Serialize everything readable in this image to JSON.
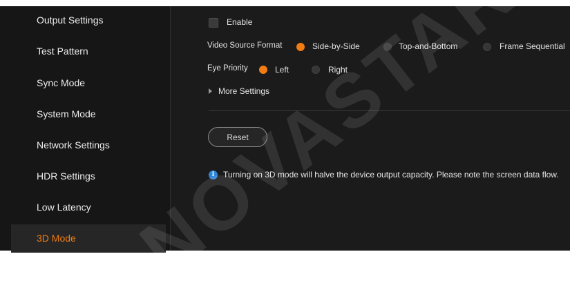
{
  "sidebar": {
    "items": [
      {
        "label": "Output Settings"
      },
      {
        "label": "Test Pattern"
      },
      {
        "label": "Sync Mode"
      },
      {
        "label": "System Mode"
      },
      {
        "label": "Network Settings"
      },
      {
        "label": "HDR Settings"
      },
      {
        "label": "Low Latency"
      },
      {
        "label": "3D Mode",
        "active": true
      }
    ]
  },
  "main": {
    "enable_label": "Enable",
    "enable_checked": false,
    "video_source_format": {
      "label": "Video Source Format",
      "options": [
        "Side-by-Side",
        "Top-and-Bottom",
        "Frame Sequential"
      ],
      "selected": "Side-by-Side"
    },
    "eye_priority": {
      "label": "Eye Priority",
      "options": [
        "Left",
        "Right"
      ],
      "selected": "Left"
    },
    "more_settings_label": "More Settings",
    "reset_label": "Reset",
    "info_text": "Turning on 3D mode will halve the device output capacity. Please note the screen data flow."
  },
  "watermark": "NOVASTAR",
  "colors": {
    "accent": "#f07c13",
    "sidebar_bg": "#161616",
    "main_bg": "#1b1b1b",
    "info_icon": "#2f86d8"
  }
}
